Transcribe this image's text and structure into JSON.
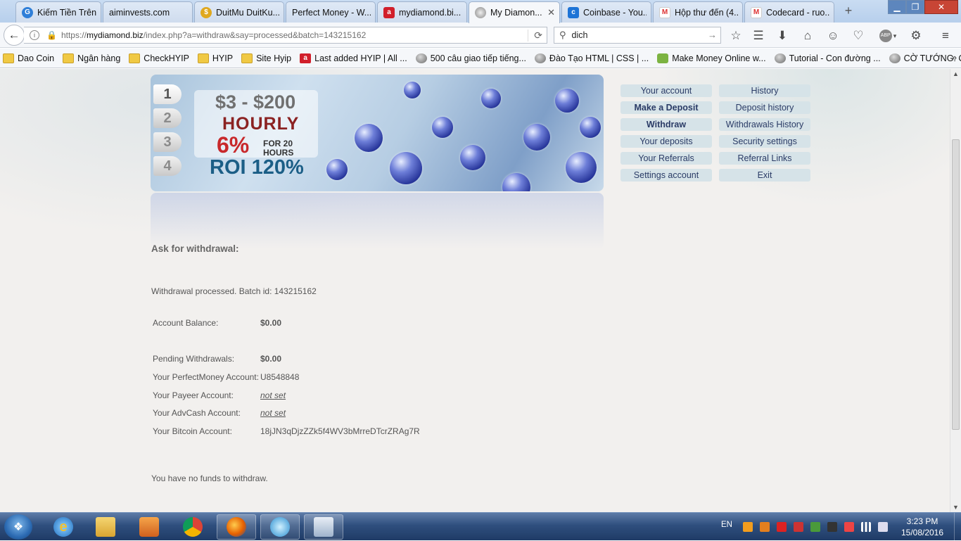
{
  "tabs": [
    {
      "title": "Kiếm Tiền Trên..."
    },
    {
      "title": "aiminvests.com"
    },
    {
      "title": "DuitMu DuitKu..."
    },
    {
      "title": "Perfect Money - W..."
    },
    {
      "title": "mydiamond.bi..."
    },
    {
      "title": "My Diamon..."
    },
    {
      "title": "Coinbase - You..."
    },
    {
      "title": "Hộp thư đến (4..."
    },
    {
      "title": "Codecard - ruo..."
    }
  ],
  "address": {
    "scheme": "https://",
    "host": "mydiamond.biz",
    "path": "/index.php?a=withdraw&say=processed&batch=143215162"
  },
  "search": {
    "value": "dich"
  },
  "bookmarks": [
    "Dao Coin",
    "Ngân hàng",
    "CheckHYIP",
    "HYIP",
    "Site Hyip",
    "Last added HYIP | All ...",
    "500 câu giao tiếp tiếng...",
    "Đào Tạo HTML | CSS | ...",
    "Make Money Online w...",
    "Tutorial - Con đường ...",
    "CỜ TƯỚNG: CHUYÊN ..."
  ],
  "banner": {
    "steps": [
      "1",
      "2",
      "3",
      "4"
    ],
    "range": "$3 - $200",
    "period": "HOURLY",
    "rate": "6%",
    "for_line1": "FOR 20",
    "for_line2": "HOURS",
    "roi": "ROI 120%"
  },
  "menu": {
    "your_account": "Your account",
    "history": "History",
    "make_deposit": "Make a Deposit",
    "deposit_history": "Deposit history",
    "withdraw": "Withdraw",
    "withdrawals_history": "Withdrawals History",
    "your_deposits": "Your deposits",
    "security_settings": "Security settings",
    "your_referrals": "Your Referrals",
    "referral_links": "Referral Links",
    "settings_account": "Settings account",
    "exit": "Exit"
  },
  "content": {
    "heading": "Ask for withdrawal:",
    "processed_msg": "Withdrawal processed. Batch id: 143215162",
    "balance_label": "Account Balance:",
    "balance_value": "$0.00",
    "pending_label": "Pending Withdrawals:",
    "pending_value": "$0.00",
    "pm_label": "Your PerfectMoney Account:",
    "pm_value": "U8548848",
    "payeer_label": "Your Payeer Account:",
    "payeer_value": "not set",
    "advcash_label": "Your AdvCash Account:",
    "advcash_value": "not set",
    "btc_label": "Your Bitcoin Account:",
    "btc_value": "18jJN3qDjzZZk5f4WV3bMrreDTcrZRAg7R",
    "no_funds": "You have no funds to withdraw."
  },
  "taskbar": {
    "lang": "EN",
    "time": "3:23 PM",
    "date": "15/08/2016"
  },
  "colors": {
    "page_bg": "#f2f0ee",
    "menu_button": "#d6e3e8",
    "menu_text": "#2a3b66",
    "taskbar": "#2f4f7e"
  }
}
